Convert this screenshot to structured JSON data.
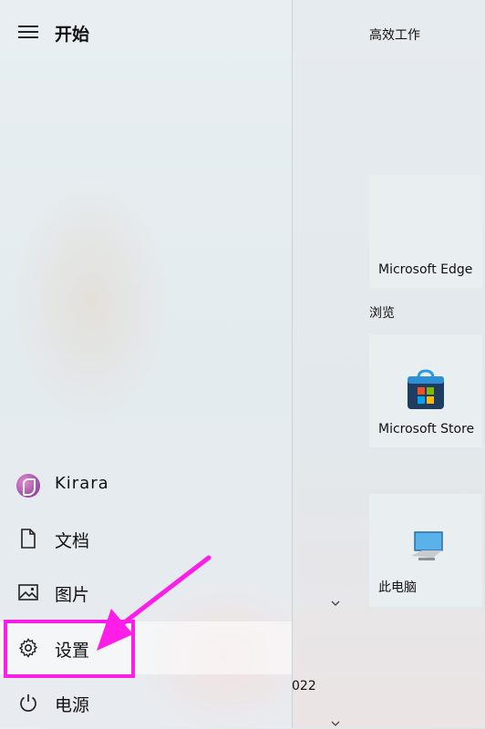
{
  "start_menu": {
    "title": "开始",
    "user": {
      "name": "Kirara"
    },
    "items": [
      {
        "label": "文档",
        "icon": "document-icon"
      },
      {
        "label": "图片",
        "icon": "pictures-icon"
      },
      {
        "label": "设置",
        "icon": "gear-icon"
      },
      {
        "label": "电源",
        "icon": "power-icon"
      }
    ]
  },
  "tiles_panel": {
    "groups": [
      {
        "label": "高效工作"
      },
      {
        "label": "浏览"
      }
    ],
    "tiles": [
      {
        "label": "Microsoft Edge",
        "icon": "edge-icon"
      },
      {
        "label": "Microsoft Store",
        "icon": "store-icon"
      },
      {
        "label": "此电脑",
        "icon": "computer-icon"
      }
    ],
    "partial_text": "022"
  },
  "annotation": {
    "color": "#ff1ee8"
  }
}
